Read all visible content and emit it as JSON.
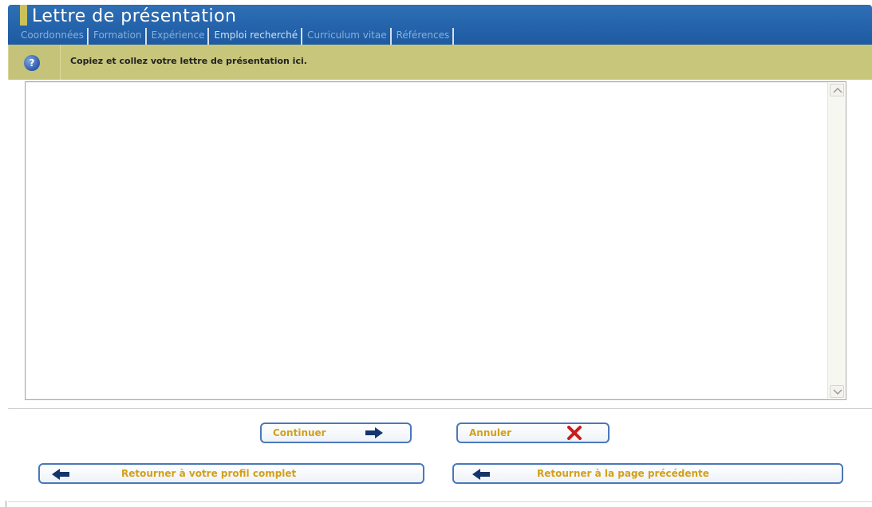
{
  "header": {
    "title": "Lettre de présentation"
  },
  "tabs": [
    {
      "label": "Coordonnées"
    },
    {
      "label": "Formation"
    },
    {
      "label": "Expérience"
    },
    {
      "label": "Emploi recherché"
    },
    {
      "label": "Curriculum vitae"
    },
    {
      "label": "Références"
    }
  ],
  "help": {
    "icon": "help-icon",
    "text": "Copiez et collez votre lettre de présentation ici."
  },
  "letter": {
    "value": "",
    "scroll_up_icon": "chevron-up-icon",
    "scroll_down_icon": "chevron-down-icon"
  },
  "buttons": {
    "continue_label": "Continuer",
    "continue_icon": "arrow-right-icon",
    "cancel_label": "Annuler",
    "cancel_icon": "close-icon",
    "profile_label": "Retourner à votre profil complet",
    "profile_icon": "arrow-left-icon",
    "previous_label": "Retourner à la page précédente",
    "previous_icon": "arrow-left-icon"
  },
  "colors": {
    "header_blue": "#1d5aa2",
    "help_bar": "#c8c67b",
    "button_text": "#d4a017",
    "button_border": "#4a78b8",
    "cancel_red": "#cc1b1b",
    "arrow_navy": "#14356e"
  }
}
